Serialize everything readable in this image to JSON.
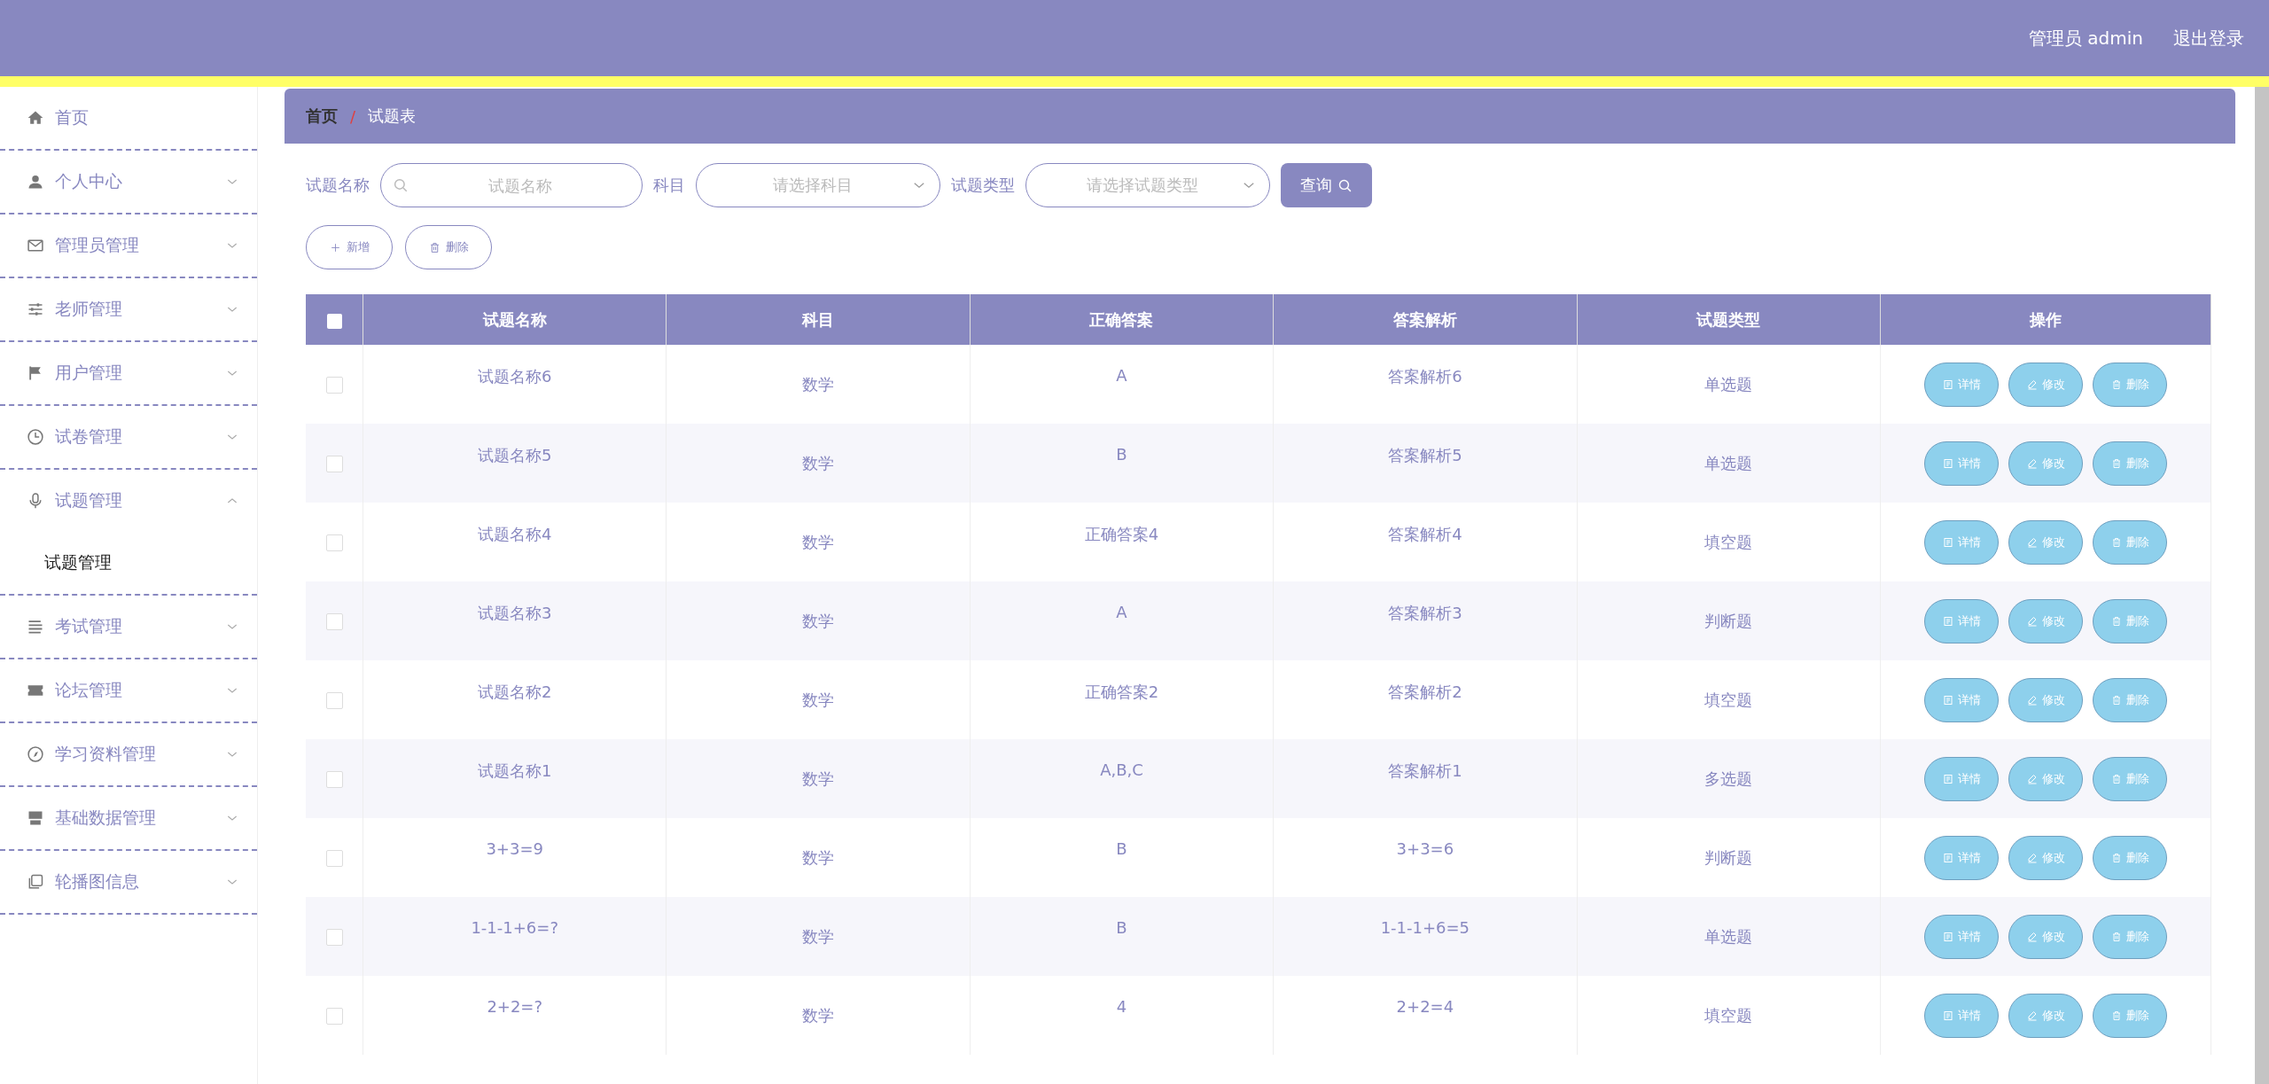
{
  "header": {
    "user": "管理员 admin",
    "logout": "退出登录"
  },
  "sidebar": {
    "items": [
      {
        "kind": "link",
        "label": "首页"
      },
      {
        "kind": "group",
        "label": "个人中心",
        "expanded": false
      },
      {
        "kind": "group",
        "label": "管理员管理",
        "expanded": false
      },
      {
        "kind": "group",
        "label": "老师管理",
        "expanded": false
      },
      {
        "kind": "group",
        "label": "用户管理",
        "expanded": false
      },
      {
        "kind": "group",
        "label": "试卷管理",
        "expanded": false
      },
      {
        "kind": "group",
        "label": "试题管理",
        "expanded": true,
        "children": [
          {
            "label": "试题管理",
            "selected": true
          }
        ]
      },
      {
        "kind": "group",
        "label": "考试管理",
        "expanded": false
      },
      {
        "kind": "group",
        "label": "论坛管理",
        "expanded": false
      },
      {
        "kind": "group",
        "label": "学习资料管理",
        "expanded": false
      },
      {
        "kind": "group",
        "label": "基础数据管理",
        "expanded": false
      },
      {
        "kind": "group",
        "label": "轮播图信息",
        "expanded": false
      }
    ]
  },
  "breadcrumb": {
    "items": [
      "首页",
      "试题表"
    ],
    "separator": "/"
  },
  "search": {
    "fields": [
      {
        "kind": "input",
        "label": "试题名称",
        "placeholder": "试题名称"
      },
      {
        "kind": "select",
        "label": "科目",
        "placeholder": "请选择科目"
      },
      {
        "kind": "select",
        "label": "试题类型",
        "placeholder": "请选择试题类型"
      }
    ],
    "button": "查询"
  },
  "actions": [
    {
      "kind": "add",
      "label": "新增"
    },
    {
      "kind": "delete",
      "label": "删除"
    }
  ],
  "table": {
    "header_checkbox": {
      "checked": false
    },
    "columns": [
      "试题名称",
      "科目",
      "正确答案",
      "答案解析",
      "试题类型",
      "操作"
    ],
    "rows": [
      {
        "checked": false,
        "cells": [
          "试题名称6",
          "数学",
          "A",
          "答案解析6",
          "单选题"
        ],
        "actions": [
          {
            "kind": "detail",
            "label": "详情"
          },
          {
            "kind": "edit",
            "label": "修改"
          },
          {
            "kind": "delete",
            "label": "删除"
          }
        ]
      },
      {
        "checked": false,
        "cells": [
          "试题名称5",
          "数学",
          "B",
          "答案解析5",
          "单选题"
        ],
        "actions": [
          {
            "kind": "detail",
            "label": "详情"
          },
          {
            "kind": "edit",
            "label": "修改"
          },
          {
            "kind": "delete",
            "label": "删除"
          }
        ]
      },
      {
        "checked": false,
        "cells": [
          "试题名称4",
          "数学",
          "正确答案4",
          "答案解析4",
          "填空题"
        ],
        "actions": [
          {
            "kind": "detail",
            "label": "详情"
          },
          {
            "kind": "edit",
            "label": "修改"
          },
          {
            "kind": "delete",
            "label": "删除"
          }
        ]
      },
      {
        "checked": false,
        "cells": [
          "试题名称3",
          "数学",
          "A",
          "答案解析3",
          "判断题"
        ],
        "actions": [
          {
            "kind": "detail",
            "label": "详情"
          },
          {
            "kind": "edit",
            "label": "修改"
          },
          {
            "kind": "delete",
            "label": "删除"
          }
        ]
      },
      {
        "checked": false,
        "cells": [
          "试题名称2",
          "数学",
          "正确答案2",
          "答案解析2",
          "填空题"
        ],
        "actions": [
          {
            "kind": "detail",
            "label": "详情"
          },
          {
            "kind": "edit",
            "label": "修改"
          },
          {
            "kind": "delete",
            "label": "删除"
          }
        ]
      },
      {
        "checked": false,
        "cells": [
          "试题名称1",
          "数学",
          "A,B,C",
          "答案解析1",
          "多选题"
        ],
        "actions": [
          {
            "kind": "detail",
            "label": "详情"
          },
          {
            "kind": "edit",
            "label": "修改"
          },
          {
            "kind": "delete",
            "label": "删除"
          }
        ]
      },
      {
        "checked": false,
        "cells": [
          "3+3=9",
          "数学",
          "B",
          "3+3=6",
          "判断题"
        ],
        "actions": [
          {
            "kind": "detail",
            "label": "详情"
          },
          {
            "kind": "edit",
            "label": "修改"
          },
          {
            "kind": "delete",
            "label": "删除"
          }
        ]
      },
      {
        "checked": false,
        "cells": [
          "1-1-1+6=?",
          "数学",
          "B",
          "1-1-1+6=5",
          "单选题"
        ],
        "actions": [
          {
            "kind": "detail",
            "label": "详情"
          },
          {
            "kind": "edit",
            "label": "修改"
          },
          {
            "kind": "delete",
            "label": "删除"
          }
        ]
      },
      {
        "checked": false,
        "cells": [
          "2+2=?",
          "数学",
          "4",
          "2+2=4",
          "填空题"
        ],
        "actions": [
          {
            "kind": "detail",
            "label": "详情"
          },
          {
            "kind": "edit",
            "label": "修改"
          },
          {
            "kind": "delete",
            "label": "删除"
          }
        ]
      }
    ]
  }
}
